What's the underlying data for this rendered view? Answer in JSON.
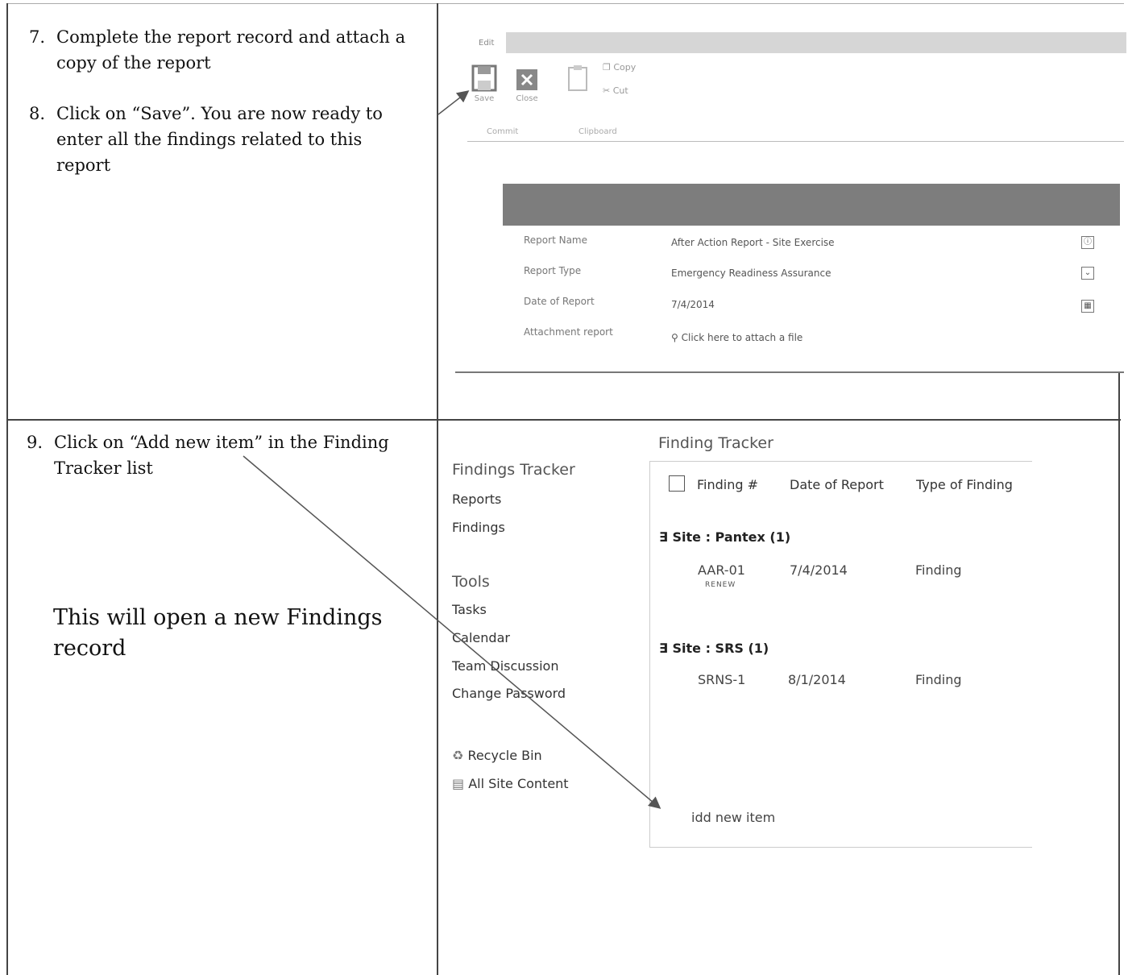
{
  "steps": {
    "s7": {
      "num": "7.",
      "line1": "Complete the report record and attach a",
      "line2": "copy of the report"
    },
    "s8": {
      "num": "8.",
      "line1": "Click on “Save”. You are now ready to",
      "line2": "enter all the findings related to this",
      "line3": "report"
    },
    "s9": {
      "num": "9.",
      "line1": "Click on “Add new item” in the Finding",
      "line2": "Tracker list"
    },
    "note_line1": "This will open a new Findings",
    "note_line2": "record"
  },
  "ribbon": {
    "tab": "Edit",
    "buttons": {
      "save": "Save",
      "close": "Close",
      "copy": "Copy",
      "cut": "Cut"
    },
    "groups": {
      "commit": "Commit",
      "clipboard": "Clipboard"
    }
  },
  "form": {
    "fields": [
      {
        "label": "Report Name",
        "value": "After Action Report - Site Exercise"
      },
      {
        "label": "Report Type",
        "value": "Emergency Readiness Assurance"
      },
      {
        "label": "Date of Report",
        "value": "7/4/2014"
      },
      {
        "label": "Attachment report",
        "value": "Click here to attach a file"
      }
    ]
  },
  "list": {
    "title": "Finding Tracker",
    "columns": [
      "Finding #",
      "Date of Report",
      "Type of Finding"
    ],
    "groups": [
      {
        "label": "∃ Site : Pantex (1)",
        "row": {
          "finding": "AAR-01",
          "badge": "RENEW",
          "date": "7/4/2014",
          "type": "Finding"
        }
      },
      {
        "label": "∃ Site : SRS (1)",
        "row": {
          "finding": "SRNS-1",
          "date": "8/1/2014",
          "type": "Finding"
        }
      }
    ],
    "add_new": "idd new item"
  },
  "nav": {
    "heading1": "Findings Tracker",
    "items1": [
      "Reports",
      "Findings"
    ],
    "heading2": "Tools",
    "items2": [
      "Tasks",
      "Calendar",
      "Team Discussion",
      "Change Password"
    ],
    "recycle": "Recycle Bin",
    "all_content": "All Site Content"
  }
}
